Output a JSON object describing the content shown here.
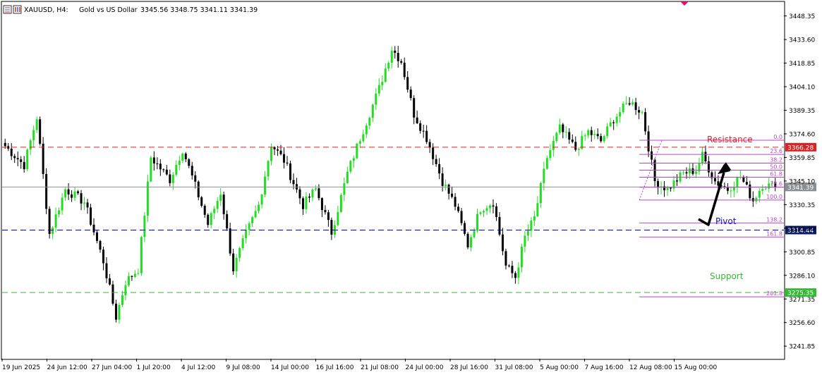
{
  "header": {
    "symbol": "XAUUSD, H4:",
    "description": "Gold vs US Dollar",
    "ohlc": "3345.56 3348.75 3341.11 3341.39"
  },
  "colors": {
    "bull": "#22dd22",
    "bear": "#000000",
    "resistance": "#dd2222",
    "pivot": "#0000cc",
    "support": "#33bb33",
    "fib": "#bb44cc",
    "current": "#8a8f94",
    "marker": "#dd1177"
  },
  "labels": {
    "resistance": "Resistance",
    "pivot": "Pivot",
    "support": "Support"
  },
  "chart_data": {
    "type": "candlestick",
    "ylim": [
      3234.0,
      3457.0
    ],
    "y_ticks": [
      "3448.35",
      "3433.60",
      "3418.85",
      "3404.10",
      "3389.35",
      "3374.60",
      "3359.85",
      "3345.10",
      "3330.35",
      "3315.60",
      "3300.85",
      "3286.10",
      "3271.35",
      "3256.60",
      "3241.85"
    ],
    "x_ticks": [
      "19 Jun 2025",
      "24 Jun 12:00",
      "27 Jun 04:00",
      "1 Jul 20:00",
      "4 Jul 12:00",
      "9 Jul 08:00",
      "14 Jul 00:00",
      "16 Jul 16:00",
      "21 Jul 08:00",
      "24 Jul 00:00",
      "28 Jul 16:00",
      "31 Jul 08:00",
      "5 Aug 00:00",
      "7 Aug 16:00",
      "12 Aug 08:00",
      "15 Aug 00:00"
    ],
    "candle_count": 244,
    "anchors": [
      [
        0,
        3367
      ],
      [
        6,
        3355
      ],
      [
        10,
        3385
      ],
      [
        14,
        3312
      ],
      [
        19,
        3340
      ],
      [
        25,
        3332
      ],
      [
        31,
        3295
      ],
      [
        35,
        3260
      ],
      [
        38,
        3282
      ],
      [
        42,
        3290
      ],
      [
        46,
        3360
      ],
      [
        52,
        3346
      ],
      [
        56,
        3365
      ],
      [
        60,
        3342
      ],
      [
        64,
        3318
      ],
      [
        68,
        3338
      ],
      [
        72,
        3290
      ],
      [
        76,
        3312
      ],
      [
        80,
        3330
      ],
      [
        84,
        3368
      ],
      [
        88,
        3358
      ],
      [
        94,
        3330
      ],
      [
        98,
        3340
      ],
      [
        103,
        3313
      ],
      [
        108,
        3350
      ],
      [
        112,
        3372
      ],
      [
        118,
        3403
      ],
      [
        122,
        3428
      ],
      [
        125,
        3420
      ],
      [
        129,
        3387
      ],
      [
        133,
        3372
      ],
      [
        138,
        3345
      ],
      [
        142,
        3330
      ],
      [
        146,
        3305
      ],
      [
        150,
        3328
      ],
      [
        154,
        3332
      ],
      [
        158,
        3292
      ],
      [
        161,
        3285
      ],
      [
        164,
        3310
      ],
      [
        167,
        3322
      ],
      [
        171,
        3360
      ],
      [
        175,
        3378
      ],
      [
        180,
        3365
      ],
      [
        184,
        3376
      ],
      [
        188,
        3370
      ],
      [
        192,
        3384
      ],
      [
        197,
        3395
      ],
      [
        201,
        3388
      ],
      [
        205,
        3345
      ],
      [
        209,
        3340
      ],
      [
        214,
        3350
      ],
      [
        218,
        3352
      ],
      [
        220,
        3361
      ],
      [
        224,
        3345
      ],
      [
        228,
        3340
      ],
      [
        232,
        3348
      ],
      [
        236,
        3333
      ],
      [
        239,
        3343
      ],
      [
        243,
        3341.39
      ]
    ],
    "levels": [
      {
        "name": "Resistance",
        "price": 3366.28,
        "tag": "3366.28"
      },
      {
        "name": "Current",
        "price": 3341.39,
        "tag": "3341.39"
      },
      {
        "name": "Pivot",
        "price": 3314.44,
        "tag": "3314.44"
      },
      {
        "name": "Support",
        "price": 3275.35,
        "tag": "3275.35"
      }
    ],
    "fibonacci": {
      "high": 3370.6,
      "low": 3333.2,
      "levels": [
        0.0,
        23.6,
        38.2,
        50.0,
        61.8,
        78.6,
        100.0,
        138.2,
        161.8,
        261.8
      ],
      "level_labels": [
        "0.0",
        "23.6",
        "38.2",
        "50.0",
        "61.8",
        "78.6",
        "100.0",
        "138.2",
        "161.8",
        "261.8"
      ]
    },
    "arrow": {
      "from_price": 3313.0,
      "via_price": 3314.5,
      "to_price": 3350.0
    }
  }
}
